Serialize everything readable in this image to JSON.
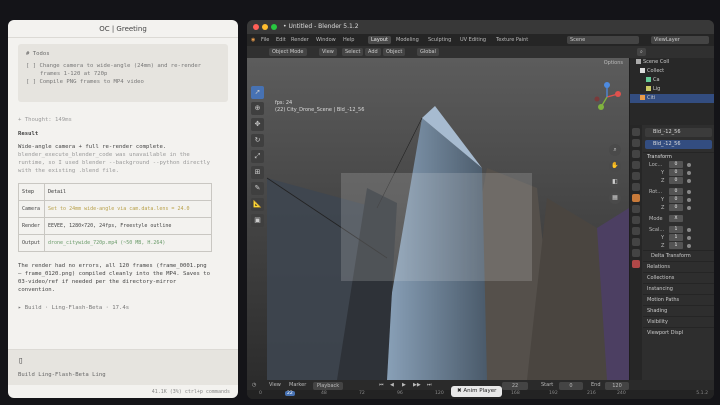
{
  "chat": {
    "title": "OC | Greeting",
    "todos_header": "# Todos",
    "todo_1": "[ ] Change camera to wide-angle (24mm) and re-render",
    "todo_1b": "frames 1-120 at 720p",
    "todo_2": "[ ] Compile PNG frames to MP4 video",
    "thought": "+ Thought: 149ms",
    "result_heading": "Result",
    "result_line": "Wide-angle camera + full re-render complete.",
    "result_dim": "blender_execute_blender_code was unavailable in the",
    "result_dim2": "runtime, so I used blender --background --python directly",
    "result_dim3": "with the existing .blend file.",
    "table": {
      "headers": [
        "Step",
        "Detail"
      ],
      "rows": [
        {
          "step": "Camera",
          "detail": "Set to 24mm wide-angle via cam.data.lens = 24.0"
        },
        {
          "step": "Render",
          "detail": "EEVEE, 1280×720, 24fps, Freestyle outline"
        },
        {
          "step": "Output",
          "detail": "drone_citywide_720p.mp4 (~50 MB, H.264)"
        }
      ]
    },
    "para_2a": "The render had no errors, all 120 frames (frame_0001.png",
    "para_2b": "– frame_0120.png) compiled cleanly into the MP4. Saves to",
    "para_2c": "03-video/ref if needed per the directory-mirror",
    "para_2d": "convention.",
    "build": "▸ Build · Ling-Flash-Beta · 17.4s",
    "input_cursor": "▯",
    "input_mode": "Build   Ling-Flash-Beta Ling",
    "footer": "41.1K (3%)  ctrl+p commands"
  },
  "blender": {
    "title": "• Untitled - Blender 5.1.2",
    "menu": [
      "File",
      "Edit",
      "Render",
      "Window",
      "Help"
    ],
    "workspaces": [
      "Layout",
      "Modeling",
      "Sculpting",
      "UV Editing",
      "Texture Paint"
    ],
    "active_workspace": "Layout",
    "scene": "Scene",
    "view_layer": "ViewLayer",
    "mode": "Object Mode",
    "header_menus": [
      "View",
      "Select",
      "Add",
      "Object"
    ],
    "transform_orientation": "Global",
    "options": "Options",
    "viewport_info_1": "fps: 24",
    "viewport_info_2": "(22) City_Drone_Scene | Bld_-12_56",
    "outliner": {
      "rows": [
        "Scene Coll",
        "Collect",
        "Ca",
        "Lig",
        "Citi"
      ]
    },
    "properties": {
      "object_name": "Bld_-12_56",
      "data_name": "Bld_-12_56",
      "transform": "Transform",
      "location_label": "Loc...",
      "rotation_label": "Rot...",
      "mode_label": "Mode",
      "mode_value": "X",
      "scale_label": "Scal...",
      "axis": [
        "X",
        "Y",
        "Z"
      ],
      "loc": [
        "0",
        "0",
        "0"
      ],
      "rot": [
        "0",
        "0",
        "0"
      ],
      "scale": [
        "1",
        "1",
        "1"
      ],
      "sections": [
        "Delta Transform",
        "Relations",
        "Collections",
        "Instancing",
        "Motion Paths",
        "Shading",
        "Visibility",
        "Viewport Displ"
      ]
    },
    "timeline": {
      "menus": [
        "View",
        "Marker",
        "Playback"
      ],
      "current_frame": "22",
      "start_label": "Start",
      "start": "0",
      "end_label": "End",
      "end": "120",
      "ticks": [
        "0",
        "22",
        "48",
        "72",
        "96",
        "120",
        "144",
        "168",
        "192",
        "216",
        "240"
      ],
      "version": "5.1.2"
    }
  },
  "dock": {
    "label": "Anim Player"
  },
  "colors": {
    "accent": "#4772b3",
    "selected_row": "#334d80"
  }
}
